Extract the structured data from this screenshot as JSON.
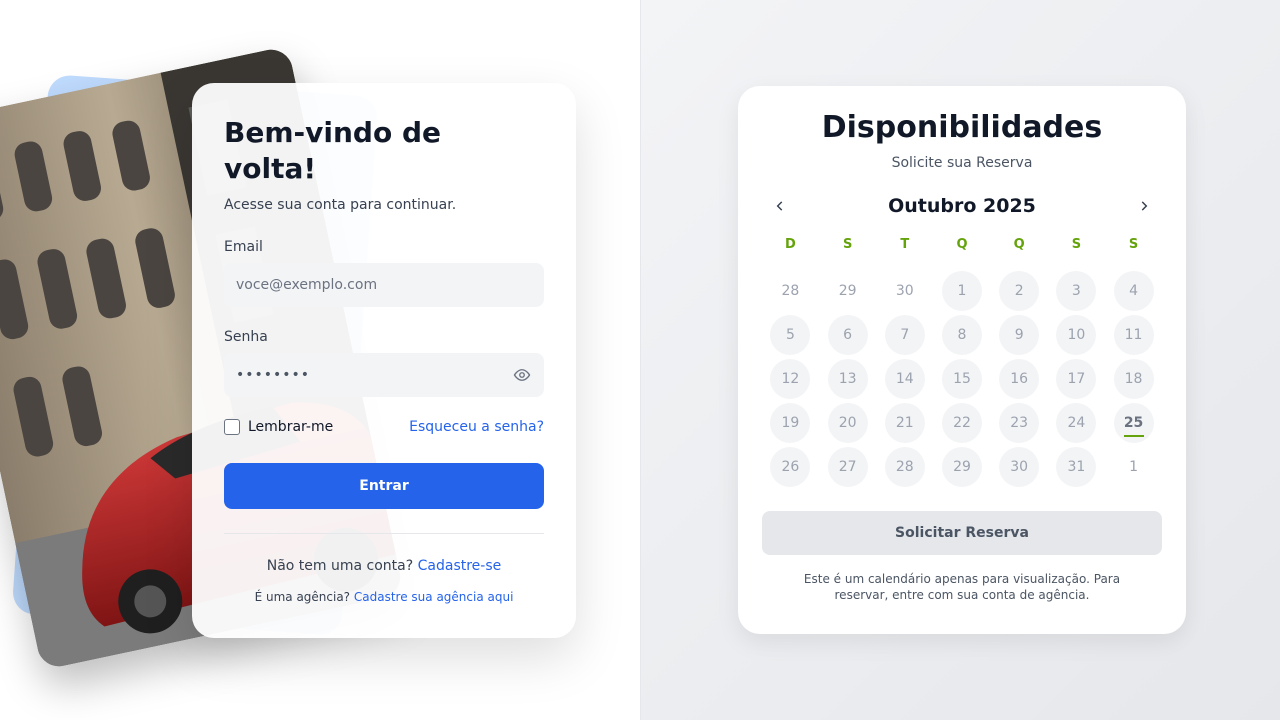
{
  "login": {
    "title": "Bem-vindo de volta!",
    "subtitle": "Acesse sua conta para continuar.",
    "email_label": "Email",
    "email_placeholder": "voce@exemplo.com",
    "password_label": "Senha",
    "password_value": "••••••••",
    "remember_label": "Lembrar-me",
    "forgot_link": "Esqueceu a senha?",
    "submit_label": "Entrar",
    "signup_text": "Não tem uma conta?",
    "signup_link": "Cadastre-se",
    "agency_text": "É uma agência?",
    "agency_link": "Cadastre sua agência aqui"
  },
  "calendar": {
    "title": "Disponibilidades",
    "subtitle": "Solicite sua Reserva",
    "month_label": "Outubro 2025",
    "weekdays": [
      "D",
      "S",
      "T",
      "Q",
      "Q",
      "S",
      "S"
    ],
    "days": [
      {
        "n": "28",
        "style": "plain"
      },
      {
        "n": "29",
        "style": "plain"
      },
      {
        "n": "30",
        "style": "plain"
      },
      {
        "n": "1",
        "style": "circle"
      },
      {
        "n": "2",
        "style": "circle"
      },
      {
        "n": "3",
        "style": "circle"
      },
      {
        "n": "4",
        "style": "circle"
      },
      {
        "n": "5",
        "style": "circle"
      },
      {
        "n": "6",
        "style": "circle"
      },
      {
        "n": "7",
        "style": "circle"
      },
      {
        "n": "8",
        "style": "circle"
      },
      {
        "n": "9",
        "style": "circle"
      },
      {
        "n": "10",
        "style": "circle"
      },
      {
        "n": "11",
        "style": "circle"
      },
      {
        "n": "12",
        "style": "circle"
      },
      {
        "n": "13",
        "style": "circle"
      },
      {
        "n": "14",
        "style": "circle"
      },
      {
        "n": "15",
        "style": "circle"
      },
      {
        "n": "16",
        "style": "circle"
      },
      {
        "n": "17",
        "style": "circle"
      },
      {
        "n": "18",
        "style": "circle"
      },
      {
        "n": "19",
        "style": "circle"
      },
      {
        "n": "20",
        "style": "circle"
      },
      {
        "n": "21",
        "style": "circle"
      },
      {
        "n": "22",
        "style": "circle"
      },
      {
        "n": "23",
        "style": "circle"
      },
      {
        "n": "24",
        "style": "circle"
      },
      {
        "n": "25",
        "style": "today"
      },
      {
        "n": "26",
        "style": "circle"
      },
      {
        "n": "27",
        "style": "circle"
      },
      {
        "n": "28",
        "style": "circle"
      },
      {
        "n": "29",
        "style": "circle"
      },
      {
        "n": "30",
        "style": "circle"
      },
      {
        "n": "31",
        "style": "circle"
      },
      {
        "n": "1",
        "style": "plain"
      }
    ],
    "button_label": "Solicitar Reserva",
    "note": "Este é um calendário apenas para visualização. Para reservar, entre com sua conta de agência."
  },
  "colors": {
    "primary": "#2563eb",
    "accent_green": "#65a30d",
    "blue_card": "#bfdbfe",
    "car_red": "#b91c1c"
  },
  "icons": {
    "password_toggle": "eye-icon",
    "prev_month": "chevron-left-icon",
    "next_month": "chevron-right-icon"
  }
}
